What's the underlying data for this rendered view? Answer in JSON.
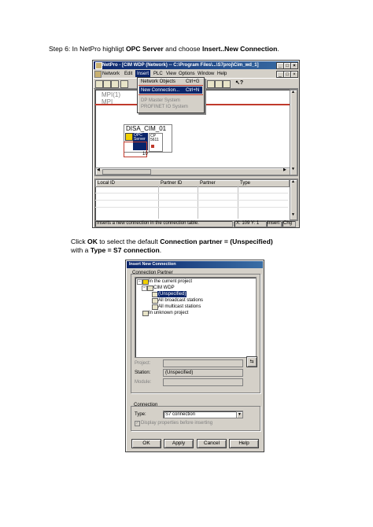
{
  "step6": {
    "prefix": "Step 6:  In NetPro highligt ",
    "b1": "OPC Server",
    "mid": " and choose ",
    "b2": "Insert..New Connection",
    "suffix": "."
  },
  "netpro": {
    "title": "NetPro - [CIM WDP (Network) -- C:\\Program Files\\...\\S7proj\\Cim_wd_1]",
    "menu": [
      "Network",
      "Edit",
      "Insert",
      "PLC",
      "View",
      "Options",
      "Window",
      "Help"
    ],
    "insert_menu": {
      "item1": "Network Objects",
      "item1_shortcut": "Ctrl+G",
      "item2": "New Connection...",
      "item2_shortcut": "Ctrl+N",
      "item3": "DP Master System",
      "item4": "PROFINET IO System"
    },
    "network_label_1": "MPI(1)",
    "network_label_2": "MPI",
    "station_name": "DISA_CIM_01",
    "module_label_1": "OPC",
    "module_label_2": "Server",
    "slot_label_1": "CP",
    "slot_label_2": "5611",
    "slot_number": "10",
    "table_headers": [
      "Local ID",
      "Partner ID",
      "Partner",
      "Type"
    ],
    "status_text": "Inserts a new connection in the connection table.",
    "status_coords": "X: 109   Y: 1",
    "status_insert": "Insert",
    "status_chg": "Chg"
  },
  "instruction2": {
    "line1_prefix": "Click ",
    "line1_b1": "OK",
    "line1_mid": " to select the default ",
    "line1_b2": "Connection partner = (Unspecified)",
    "line2_prefix": "with a ",
    "line2_b": "Type = S7 connection",
    "line2_suffix": "."
  },
  "dialog": {
    "title": "Insert New Connection",
    "group_partner": "Connection Partner",
    "tree": [
      "In the current project",
      "CIM WDP",
      "(Unspecified)",
      "All broadcast stations",
      "All multicast stations",
      "In unknown project"
    ],
    "project_label": "Project:",
    "station_label": "Station:",
    "station_value": "(Unspecified)",
    "module_label": "Module:",
    "group_connection": "Connection",
    "type_label": "Type:",
    "type_value": "S7 connection",
    "checkbox_label": "Display properties before inserting",
    "buttons": {
      "ok": "OK",
      "apply": "Apply",
      "cancel": "Cancel",
      "help": "Help"
    }
  }
}
